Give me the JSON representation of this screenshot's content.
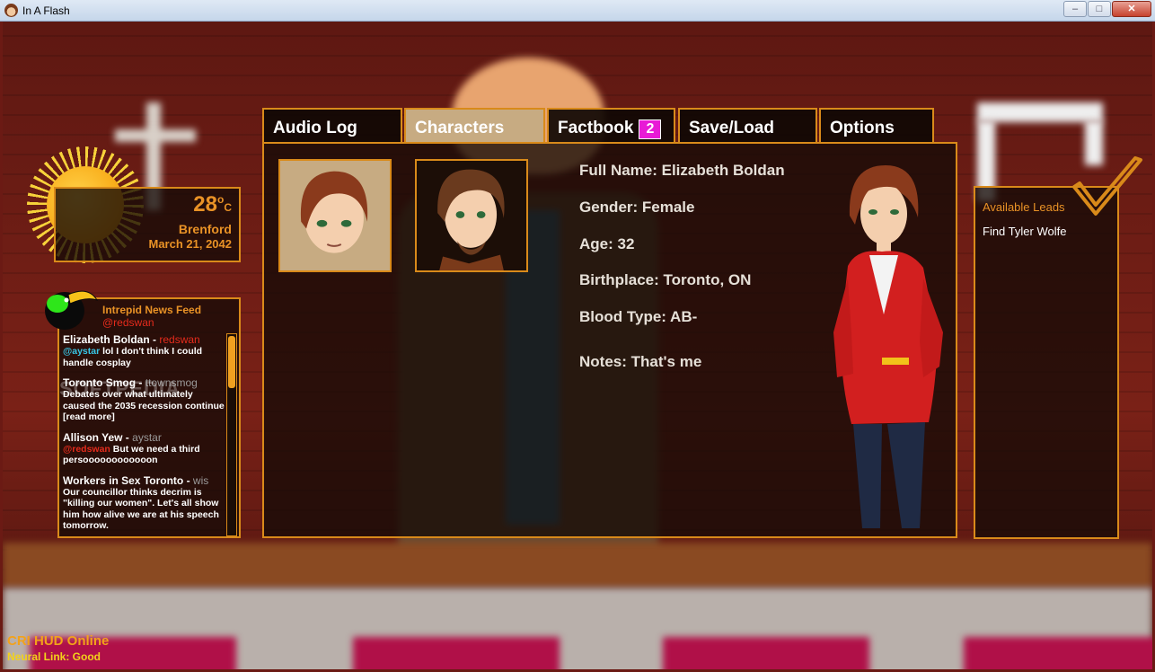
{
  "window": {
    "title": "In A Flash",
    "min_label": "–",
    "max_label": "□",
    "close_label": "✕"
  },
  "weather": {
    "temperature": "28",
    "unit": "o",
    "unit_c": "C",
    "city": "Brenford",
    "date": "March 21, 2042"
  },
  "news": {
    "title": "Intrepid News Feed",
    "handle": "@redswan",
    "posts": [
      {
        "author": "Elizabeth Boldan",
        "sep": " - ",
        "user": "redswan",
        "mention": "@aystar",
        "text": " lol I don't think I could handle cosplay"
      },
      {
        "author": "Toronto Smog",
        "sep": " - ",
        "user": "ttownsmog",
        "text": "Debates over what ultimately caused the 2035 recession continue [read more]"
      },
      {
        "author": "Allison Yew",
        "sep": " - ",
        "user": "aystar",
        "mention": "@redswan",
        "text": " But we need a third persoooooooooooon"
      },
      {
        "author": "Workers in Sex Toronto",
        "sep": " - ",
        "user": "wis",
        "text": "Our councillor thinks decrim is \"killing our women\". Let's all show him how alive we are at his speech tomorrow."
      }
    ],
    "watermark": "SOFTPEDIA"
  },
  "tabs": [
    {
      "label": "Audio Log",
      "active": false
    },
    {
      "label": "Characters",
      "active": true
    },
    {
      "label": "Factbook",
      "badge": "2",
      "active": false
    },
    {
      "label": "Save/Load",
      "active": false
    },
    {
      "label": "Options",
      "active": false
    }
  ],
  "character": {
    "full_name": "Full Name: Elizabeth Boldan",
    "gender": "Gender: Female",
    "age": "Age: 32",
    "birthplace": "Birthplace: Toronto, ON",
    "blood_type": "Blood Type: AB-",
    "notes": "Notes: That's me"
  },
  "leads": {
    "title": "Available Leads",
    "items": [
      "Find Tyler Wolfe"
    ]
  },
  "status": {
    "line1": "CRI HUD Online",
    "line2": "Neural Link: Good"
  },
  "colors": {
    "accent": "#d98a1a",
    "text_orange": "#e99226",
    "badge": "#e81ad6",
    "tab_active": "#c7ab82"
  }
}
